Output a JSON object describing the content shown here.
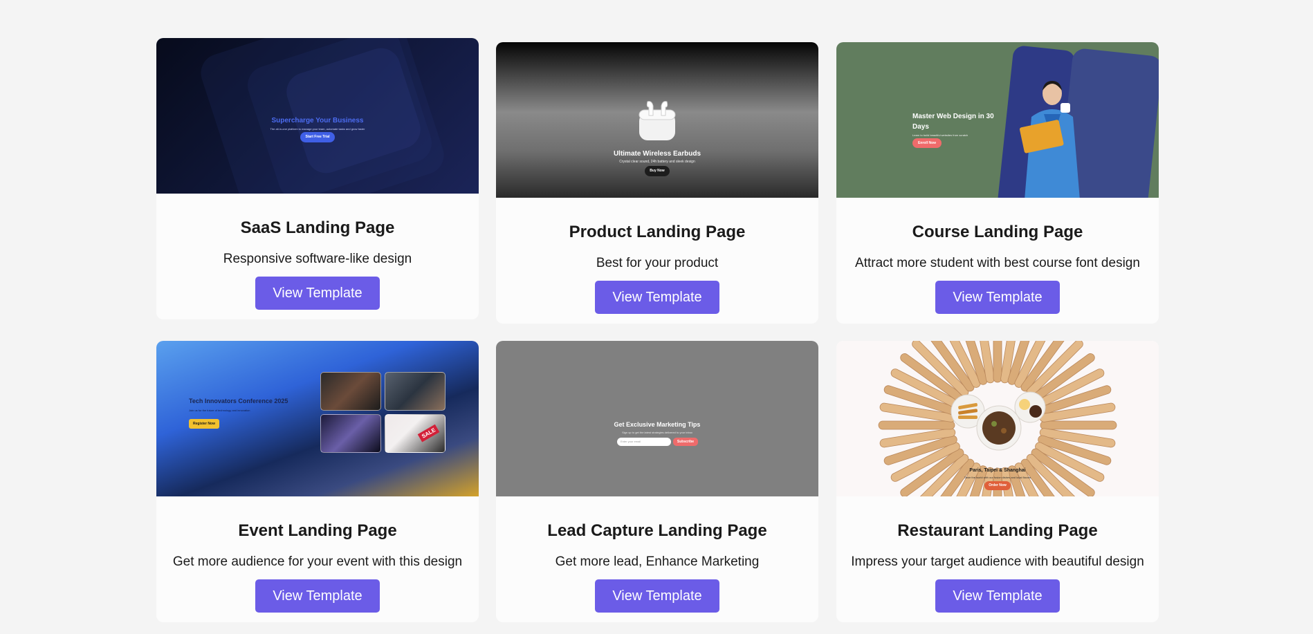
{
  "button_label": "View Template",
  "cards": [
    {
      "title": "SaaS Landing Page",
      "description": "Responsive software-like design",
      "preview": {
        "headline": "Supercharge Your Business",
        "subtext": "The all-in-one platform to manage your team, automate tasks and grow faster",
        "cta": "Start Free Trial"
      }
    },
    {
      "title": "Product Landing Page",
      "description": "Best for your product",
      "preview": {
        "headline": "Ultimate Wireless Earbuds",
        "subtext": "Crystal clear sound, 24h battery and sleek design",
        "cta": "Buy Now"
      }
    },
    {
      "title": "Course Landing Page",
      "description": "Attract more student with best course font design",
      "preview": {
        "headline": "Master Web Design in 30 Days",
        "subtext": "Learn to build beautiful websites from scratch",
        "cta": "Enroll Now"
      }
    },
    {
      "title": "Event Landing Page",
      "description": "Get more audience for your event with this design",
      "preview": {
        "headline": "Tech Innovators Conference 2025",
        "subtext": "Join us for the future of technology and innovation",
        "cta": "Register Now",
        "badge": "SALE"
      }
    },
    {
      "title": "Lead Capture Landing Page",
      "description": "Get more lead, Enhance Marketing",
      "preview": {
        "headline": "Get Exclusive Marketing Tips",
        "subtext": "Sign up to get the latest strategies delivered to your inbox",
        "input_placeholder": "Enter your email",
        "cta": "Subscribe"
      }
    },
    {
      "title": "Restaurant Landing Page",
      "description": "Impress your target audience with beautiful design",
      "preview": {
        "headline": "Paris, Taipei & Shanghai",
        "subtext": "Taste the world with our fusion dishes and local flavors",
        "cta": "Order Now"
      }
    }
  ],
  "colors": {
    "page_bg": "#f4f4f4",
    "card_bg": "#fcfcfc",
    "button_bg": "#6b5ce7",
    "button_text": "#ffffff"
  }
}
